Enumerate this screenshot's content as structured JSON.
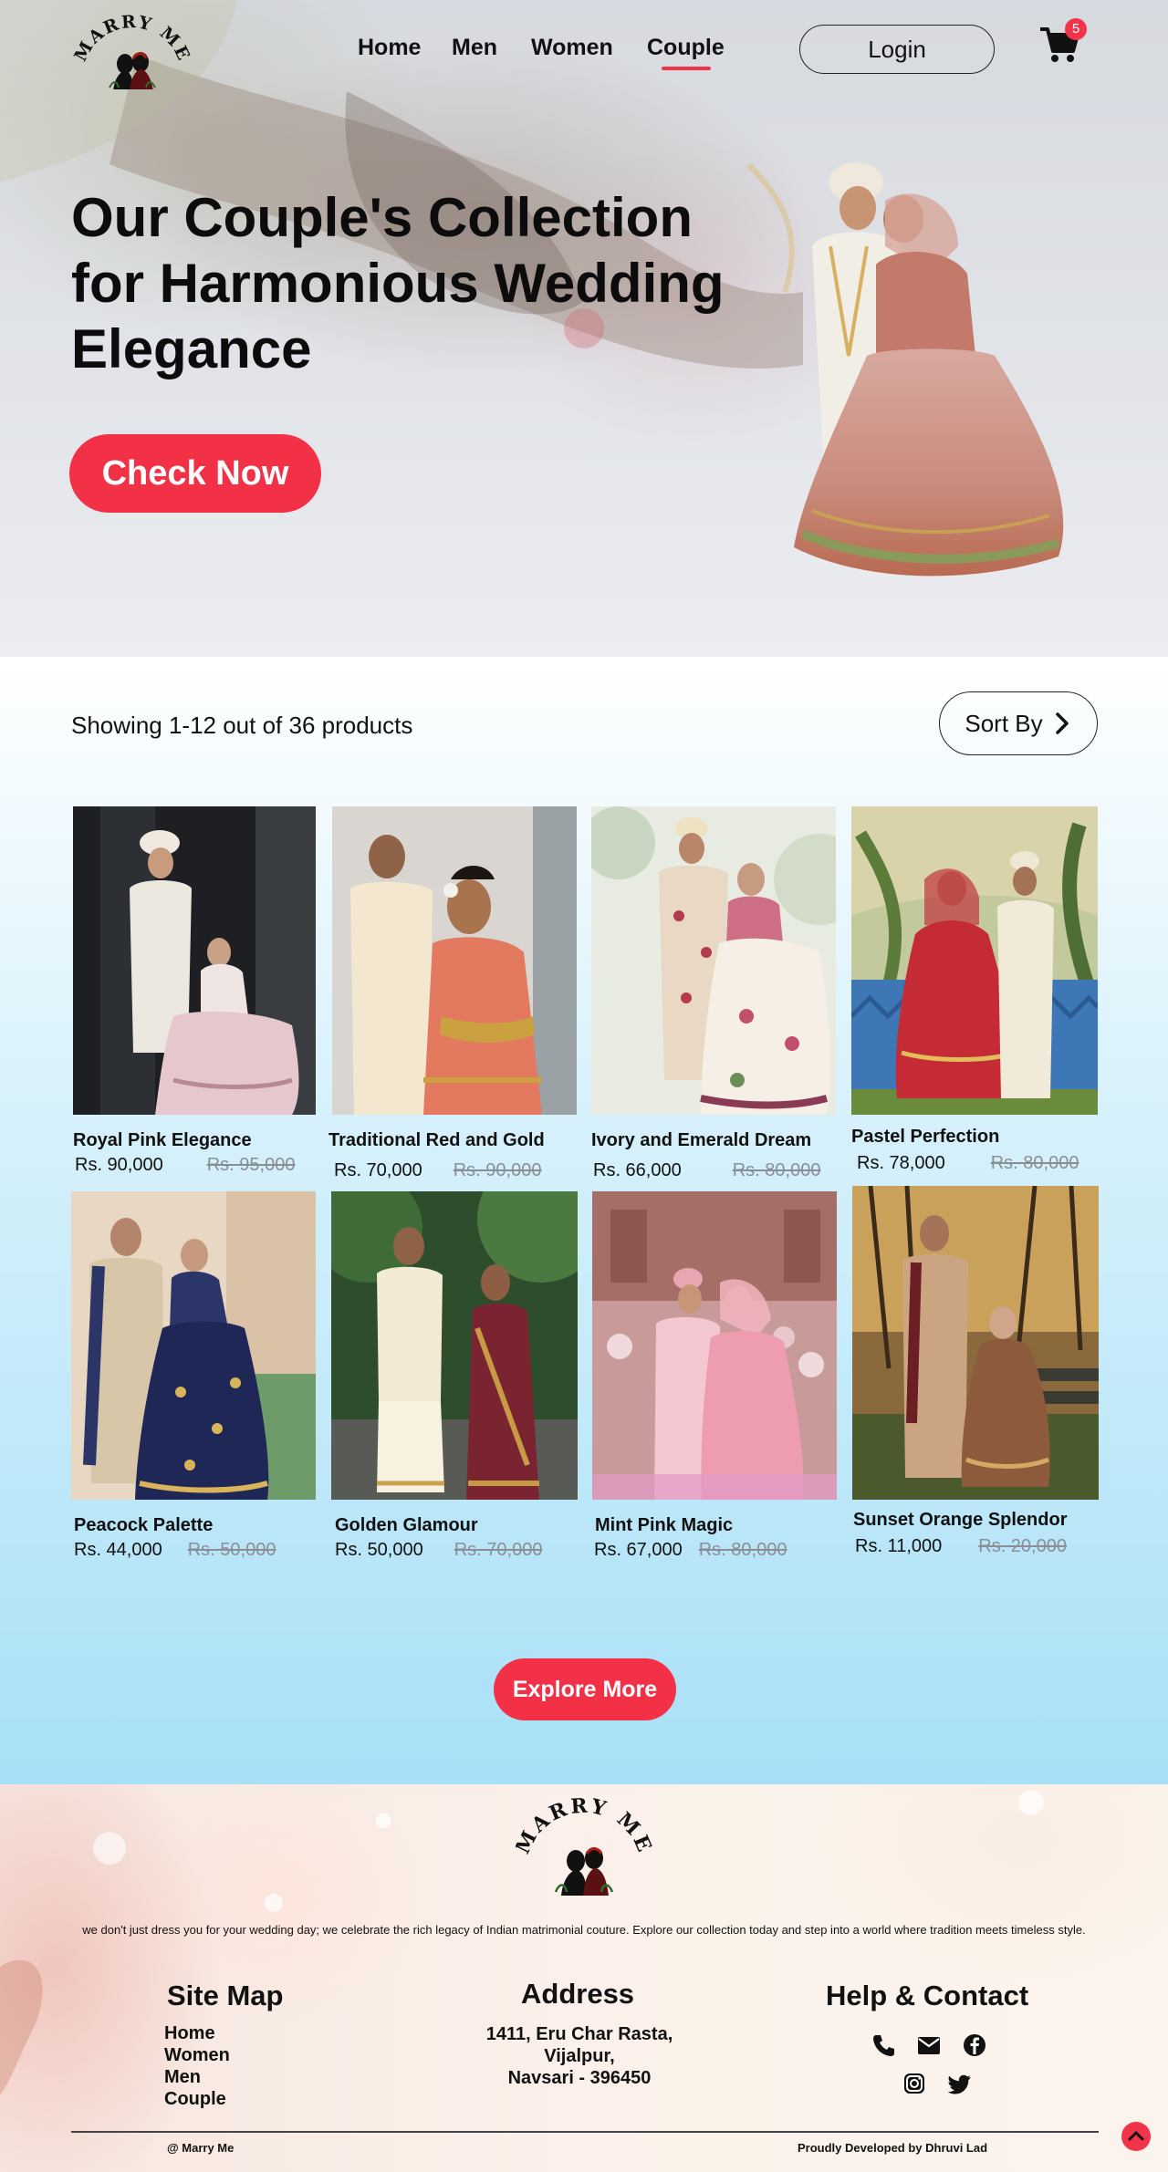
{
  "brand": {
    "name": "MARRY ME"
  },
  "nav": {
    "items": [
      {
        "label": "Home",
        "active": false
      },
      {
        "label": "Men",
        "active": false
      },
      {
        "label": "Women",
        "active": false
      },
      {
        "label": "Couple",
        "active": true
      }
    ],
    "login_label": "Login",
    "cart_count": "5",
    "cart_icon": "cart-icon"
  },
  "hero": {
    "title": "Our Couple's Collection for Harmonious Wedding Elegance",
    "cta_label": "Check Now"
  },
  "listing": {
    "showing_text": "Showing 1-12 out of 36 products",
    "sort_label": "Sort By",
    "products": [
      {
        "name": "Royal Pink Elegance",
        "price": "Rs. 90,000",
        "old_price": "Rs. 95,000"
      },
      {
        "name": "Traditional Red and Gold",
        "price": "Rs. 70,000",
        "old_price": "Rs. 90,000"
      },
      {
        "name": "Ivory and Emerald Dream",
        "price": "Rs. 66,000",
        "old_price": "Rs. 80,000"
      },
      {
        "name": "Pastel Perfection",
        "price": "Rs. 78,000",
        "old_price": "Rs. 80,000"
      },
      {
        "name": "Peacock Palette",
        "price": "Rs. 44,000",
        "old_price": "Rs. 50,000"
      },
      {
        "name": "Golden Glamour",
        "price": "Rs. 50,000",
        "old_price": "Rs. 70,000"
      },
      {
        "name": "Mint Pink Magic",
        "price": "Rs. 67,000",
        "old_price": "Rs. 80,000"
      },
      {
        "name": "Sunset Orange Splendor",
        "price": "Rs. 11,000",
        "old_price": "Rs. 20,000"
      }
    ],
    "explore_label": "Explore More"
  },
  "footer": {
    "tagline": "we don't just dress you for your wedding day; we celebrate the rich legacy of Indian matrimonial couture. Explore our collection today and step into a world where tradition meets timeless style.",
    "sitemap_title": "Site Map",
    "sitemap_links": [
      "Home",
      "Women",
      "Men",
      "Couple"
    ],
    "address_title": "Address",
    "address_lines": [
      "1411, Eru Char Rasta,",
      "Vijalpur,",
      "Navsari - 396450"
    ],
    "help_title": "Help & Contact",
    "contact_icons": [
      "phone-icon",
      "mail-icon",
      "facebook-icon",
      "instagram-icon",
      "twitter-icon"
    ],
    "copyright": "@ Marry Me",
    "developed_by": "Proudly Developed by Dhruvi Lad"
  },
  "colors": {
    "accent": "#f33146",
    "text": "#111111",
    "sky": "#a8e0f7"
  }
}
